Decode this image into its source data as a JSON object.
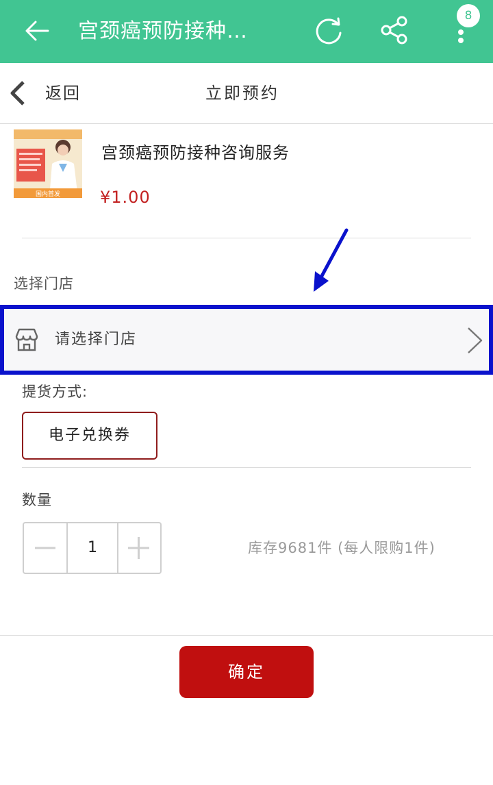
{
  "appbar": {
    "title": "宫颈癌预防接种…",
    "badge_count": "8",
    "bg_color": "#41c592",
    "icons": [
      "back-arrow-icon",
      "refresh-icon",
      "share-icon",
      "more-vertical-icon"
    ]
  },
  "subheader": {
    "back_label": "返回",
    "title": "立即预约"
  },
  "product": {
    "name": "宫颈癌预防接种咨询服务",
    "price": "¥1.00",
    "thumb_caption": "国内首发"
  },
  "store": {
    "section_label": "选择门店",
    "placeholder": "请选择门店",
    "icon": "store-icon"
  },
  "delivery": {
    "label": "提货方式:",
    "option": "电子兑换券"
  },
  "quantity": {
    "label": "数量",
    "value": "1",
    "stock_text": "库存9681件 (每人限购1件)"
  },
  "confirm_label": "确定",
  "colors": {
    "accent": "#41c592",
    "price": "#c21f1f",
    "confirm": "#c00f0f",
    "highlight_border": "#0a12cc"
  }
}
